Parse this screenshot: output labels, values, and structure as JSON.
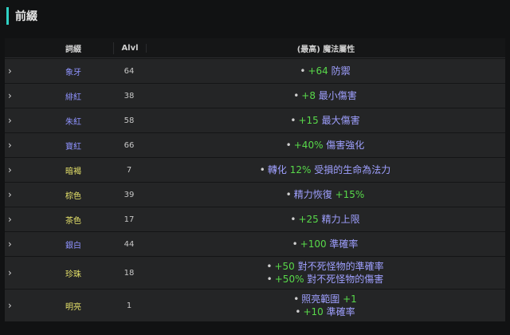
{
  "page": {
    "title": "前綴"
  },
  "table": {
    "headers": {
      "name": "詞綴",
      "alvl": "Alvl",
      "attr": "(最高) 魔法屬性"
    },
    "rows": [
      {
        "name": "象牙",
        "alvl": "64",
        "color": "blue",
        "attrs": [
          [
            {
              "t": "+64 ",
              "c": "green"
            },
            {
              "t": "防禦",
              "c": "purple"
            }
          ]
        ]
      },
      {
        "name": "緋紅",
        "alvl": "38",
        "color": "blue",
        "attrs": [
          [
            {
              "t": "+8 ",
              "c": "green"
            },
            {
              "t": "最小傷害",
              "c": "purple"
            }
          ]
        ]
      },
      {
        "name": "朱紅",
        "alvl": "58",
        "color": "blue",
        "attrs": [
          [
            {
              "t": "+15 ",
              "c": "green"
            },
            {
              "t": "最大傷害",
              "c": "purple"
            }
          ]
        ]
      },
      {
        "name": "寶紅",
        "alvl": "66",
        "color": "blue",
        "attrs": [
          [
            {
              "t": "+40% ",
              "c": "green"
            },
            {
              "t": "傷害強化",
              "c": "purple"
            }
          ]
        ]
      },
      {
        "name": "暗褐",
        "alvl": "7",
        "color": "yellow",
        "attrs": [
          [
            {
              "t": "轉化 ",
              "c": "purple"
            },
            {
              "t": "12% ",
              "c": "green"
            },
            {
              "t": "受損的生命為法力",
              "c": "purple"
            }
          ]
        ]
      },
      {
        "name": "棕色",
        "alvl": "39",
        "color": "yellow",
        "attrs": [
          [
            {
              "t": "精力恢復 ",
              "c": "purple"
            },
            {
              "t": "+15%",
              "c": "green"
            }
          ]
        ]
      },
      {
        "name": "茶色",
        "alvl": "17",
        "color": "yellow",
        "attrs": [
          [
            {
              "t": "+25 ",
              "c": "green"
            },
            {
              "t": "精力上限",
              "c": "purple"
            }
          ]
        ]
      },
      {
        "name": "銀白",
        "alvl": "44",
        "color": "blue",
        "attrs": [
          [
            {
              "t": "+100 ",
              "c": "green"
            },
            {
              "t": "準確率",
              "c": "purple"
            }
          ]
        ]
      },
      {
        "name": "珍珠",
        "alvl": "18",
        "color": "yellow",
        "attrs": [
          [
            {
              "t": "+50 ",
              "c": "green"
            },
            {
              "t": "對不死怪物的準確率",
              "c": "purple"
            }
          ],
          [
            {
              "t": "+50% ",
              "c": "green"
            },
            {
              "t": "對不死怪物的傷害",
              "c": "purple"
            }
          ]
        ]
      },
      {
        "name": "明亮",
        "alvl": "1",
        "color": "yellow",
        "attrs": [
          [
            {
              "t": "照亮範圍 ",
              "c": "purple"
            },
            {
              "t": "+1",
              "c": "green"
            }
          ],
          [
            {
              "t": "+10 ",
              "c": "green"
            },
            {
              "t": "準確率",
              "c": "purple"
            }
          ]
        ]
      }
    ]
  },
  "icons": {
    "row_expand": "chevron-right-icon",
    "bullet": "bullet-icon"
  },
  "colors": {
    "accent": "#2fd1c4",
    "green": "#58d94a",
    "purple": "#9fa0ff",
    "blue": "#8f93ff",
    "yellow": "#e8e46b"
  }
}
